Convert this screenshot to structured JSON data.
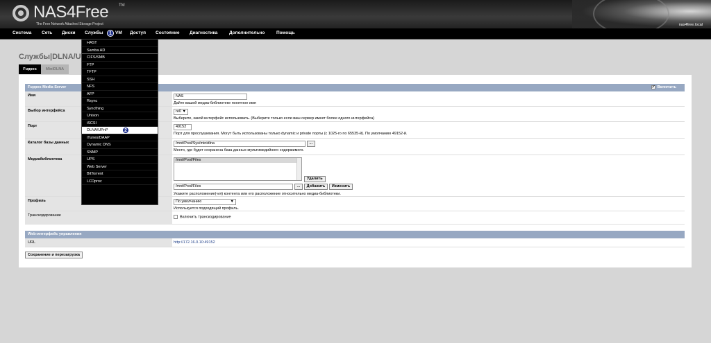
{
  "header": {
    "logo_text": "NAS4Free",
    "logo_tm": "TM",
    "tagline": "The Free Network Attached Storage Project",
    "hostname": "nas4free.local"
  },
  "nav": {
    "items": [
      "Система",
      "Сеть",
      "Диски",
      "Службы",
      "VM",
      "Доступ",
      "Состояние",
      "Диагностика",
      "Дополнительно",
      "Помощь"
    ],
    "badge1": "1"
  },
  "dropdown": {
    "items": [
      "HAST",
      "Samba AD",
      "CIFS/SMB",
      "FTP",
      "TFTP",
      "SSH",
      "NFS",
      "AFP",
      "Rsync",
      "Syncthing",
      "Unison",
      "iSCSI",
      "DLNA/UPnP",
      "iTunes/DAAP",
      "Dynamic DNS",
      "SNMP",
      "UPS",
      "Web Server",
      "BitTorrent",
      "LCDproc"
    ],
    "highlighted": "DLNA/UPnP",
    "badge2": "2"
  },
  "page": {
    "title": "Службы|DLNA/UPnP",
    "tabs": [
      "Fuppes",
      "MiniDLNA"
    ]
  },
  "section1": {
    "title": "Fuppes Media Server",
    "enable_label": "Включить",
    "rows": {
      "name": {
        "label": "Имя",
        "value": "NAS",
        "hint": "Дайте вашей медиа-библиотеке понятное имя"
      },
      "iface": {
        "label": "Выбор интерфейса",
        "value": "re0",
        "hint": "Выберите, какой интерфейс использовать. (Выберите только если ваш сервер имеет более одного интерфейса)"
      },
      "port": {
        "label": "Порт",
        "value": "49152",
        "hint": "Порт для прослушивания. Могут быть использованы только dynamic и private порты (с 1025-го по 65535-й). По умолчанию 49152-й."
      },
      "db": {
        "label": "Каталог базы данных",
        "value": "/mnt/Pool/Sys/minidlna",
        "browse": "...",
        "hint": "Место, где будет сохранена база данных мультимедийного содержимого."
      },
      "media": {
        "label": "Медиабиблиотека",
        "list_item": "/mnt/Pool/Files",
        "delete": "Удалить",
        "value": "/mnt/Pool/Files",
        "browse": "...",
        "add": "Добавить",
        "change": "Изменить",
        "hint": "Укажите расположение(-ия) контента или его расположение относительно медиа-библиотеки."
      },
      "profile": {
        "label": "Профиль",
        "value": "По умолчанию",
        "hint": "Используется подходящий профиль."
      },
      "transcode": {
        "label": "Транскодирование",
        "check_label": "Включить транскодирование"
      }
    }
  },
  "section2": {
    "title": "Web-интерфейс управления",
    "url_label": "URL",
    "url_value": "http://172.16.0.10:49152"
  },
  "save_button": "Сохранение и перезагрузка"
}
